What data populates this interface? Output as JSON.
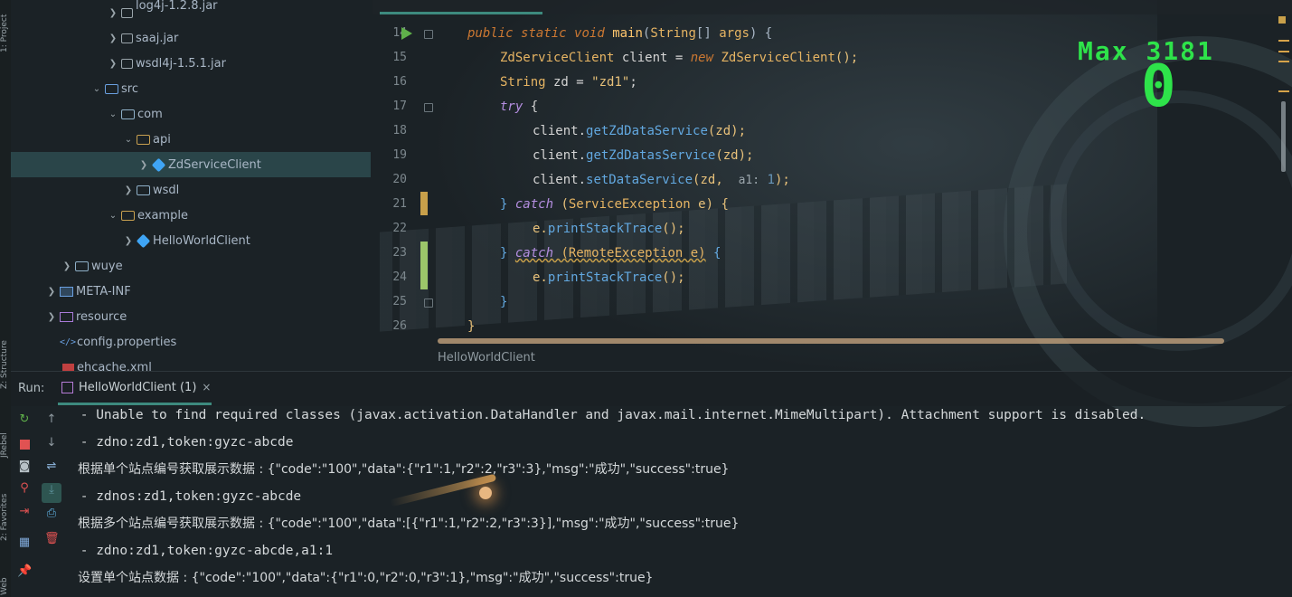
{
  "left_strip": {
    "project_label": "1: Project",
    "structure_label": "Z: Structure",
    "jrebel_label": "JRebel",
    "favorites_label": "2: Favorites",
    "web_label": "Web"
  },
  "tree": {
    "items": [
      {
        "label": "log4j-1.2.8.jar",
        "type": "jar",
        "expanded": false
      },
      {
        "label": "saaj.jar",
        "type": "jar",
        "expanded": false
      },
      {
        "label": "wsdl4j-1.5.1.jar",
        "type": "jar",
        "expanded": false
      },
      {
        "label": "src",
        "type": "src",
        "expanded": true
      },
      {
        "label": "com",
        "type": "folder",
        "expanded": true
      },
      {
        "label": "api",
        "type": "package",
        "expanded": true
      },
      {
        "label": "ZdServiceClient",
        "type": "class",
        "selected": true
      },
      {
        "label": "wsdl",
        "type": "folder",
        "expanded": false
      },
      {
        "label": "example",
        "type": "package",
        "expanded": true
      },
      {
        "label": "HelloWorldClient",
        "type": "class"
      },
      {
        "label": "wuye",
        "type": "folder",
        "expanded": false
      },
      {
        "label": "META-INF",
        "type": "meta",
        "expanded": false
      },
      {
        "label": "resource",
        "type": "resource",
        "expanded": false
      },
      {
        "label": "config.properties",
        "type": "properties"
      },
      {
        "label": "ehcache.xml",
        "type": "xml"
      }
    ]
  },
  "editor": {
    "line_numbers": [
      "14",
      "15",
      "16",
      "17",
      "18",
      "19",
      "20",
      "21",
      "22",
      "23",
      "24",
      "25",
      "26"
    ],
    "code": {
      "l14_public": "public",
      "l14_static": "static",
      "l14_void": "void",
      "l14_main": "main",
      "l14_rest_a": "(",
      "l14_string": "String",
      "l14_rest_b": "[] ",
      "l14_args": "args",
      "l14_rest_c": ") {",
      "l15_type": "ZdServiceClient",
      "l15_var": " client = ",
      "l15_new": "new",
      "l15_ctor": " ZdServiceClient",
      "l15_end": "();",
      "l16_type": "String",
      "l16_var": " zd = ",
      "l16_str": "\"zd1\"",
      "l16_end": ";",
      "l17_try": "try",
      "l17_end": " {",
      "l18_obj": "client.",
      "l18_m": "getZdDataService",
      "l18_end": "(zd);",
      "l19_obj": "client.",
      "l19_m": "getZdDatasService",
      "l19_end": "(zd);",
      "l20_obj": "client.",
      "l20_m": "setDataService",
      "l20_a": "(zd,  ",
      "l20_hint": "a1:",
      "l20_num": " 1",
      "l20_end": ");",
      "l21_close": "} ",
      "l21_catch": "catch",
      "l21_open": " (",
      "l21_type": "ServiceException",
      "l21_var": " e",
      "l21_end": ") {",
      "l22_obj": "e.",
      "l22_m": "printStackTrace",
      "l22_end": "();",
      "l23_close": "} ",
      "l23_catch": "catch",
      "l23_type": " (RemoteException e)",
      "l23_end": " {",
      "l24_obj": "e.",
      "l24_m": "printStackTrace",
      "l24_end": "();",
      "l25": "}",
      "l26": "}"
    },
    "breadcrumb": "HelloWorldClient"
  },
  "game": {
    "max_label": "Max",
    "max_value": "3181",
    "current_score": "0"
  },
  "run": {
    "label": "Run:",
    "tab_label": "HelloWorldClient (1)",
    "tab_close": "×"
  },
  "console": {
    "lines": [
      " - Unable to find required classes (javax.activation.DataHandler and javax.mail.internet.MimeMultipart). Attachment support is disabled.",
      " - zdno:zd1,token:gyzc-abcde",
      "根据单个站点编号获取展示数据 : {\"code\":\"100\",\"data\":{\"r1\":1,\"r2\":2,\"r3\":3},\"msg\":\"成功\",\"success\":true}",
      " - zdnos:zd1,token:gyzc-abcde",
      "根据多个站点编号获取展示数据 : {\"code\":\"100\",\"data\":[{\"r1\":1,\"r2\":2,\"r3\":3}],\"msg\":\"成功\",\"success\":true}",
      " - zdno:zd1,token:gyzc-abcde,a1:1",
      "设置单个站点数据 : {\"code\":\"100\",\"data\":{\"r1\":0,\"r2\":0,\"r3\":1},\"msg\":\"成功\",\"success\":true}"
    ]
  },
  "colors": {
    "accent": "#3d8a7e",
    "score_green": "#2ee34a",
    "keyword": "#cc7832",
    "string": "#6a8759"
  }
}
